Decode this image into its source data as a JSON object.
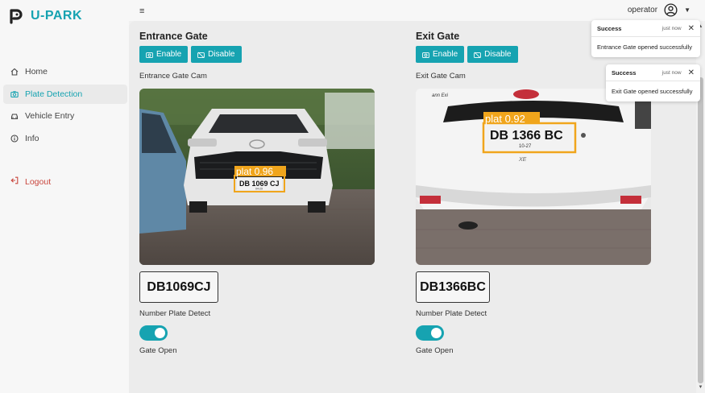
{
  "brand": {
    "name": "U-PARK",
    "icon": "p-logo-icon",
    "accent": "#16a3b1"
  },
  "topbar": {
    "menu_icon": "hamburger-icon",
    "menu_glyph": "≡",
    "username": "operator",
    "caret": "▼"
  },
  "sidebar": {
    "items": [
      {
        "label": "Home",
        "icon": "home-icon",
        "active": false
      },
      {
        "label": "Plate Detection",
        "icon": "camera-icon",
        "active": true
      },
      {
        "label": "Vehicle Entry",
        "icon": "car-icon",
        "active": false
      },
      {
        "label": "Info",
        "icon": "info-icon",
        "active": false
      }
    ],
    "logout": "Logout"
  },
  "entrance": {
    "title": "Entrance Gate",
    "enable_label": "Enable",
    "disable_label": "Disable",
    "cam_label": "Entrance Gate Cam",
    "detection_tag": "plat 0.96",
    "camera_plate_text": "DB 1069 CJ",
    "camera_plate_sub": "04-29",
    "plate": "DB1069CJ",
    "detect_label": "Number Plate Detect",
    "gate_open_label": "Gate Open",
    "gate_open": true
  },
  "exit": {
    "title": "Exit Gate",
    "enable_label": "Enable",
    "disable_label": "Disable",
    "cam_label": "Exit Gate Cam",
    "detection_tag": "plat 0.92",
    "camera_plate_text": "DB 1366 BC",
    "camera_plate_sub": "10-27",
    "badge_text": "XE",
    "plate": "DB1366BC",
    "detect_label": "Number Plate Detect",
    "gate_open_label": "Gate Open",
    "gate_open": true
  },
  "toasts": [
    {
      "title": "Success",
      "time": "just now",
      "message": "Entrance Gate opened successfully"
    },
    {
      "title": "Success",
      "time": "just now",
      "message": "Exit Gate opened successfully"
    }
  ],
  "scrollbar": {
    "up": "▲",
    "down": "▼"
  },
  "colors": {
    "accent": "#16a3b1",
    "logout": "#c9463d",
    "detection_box": "#f0a51c"
  }
}
